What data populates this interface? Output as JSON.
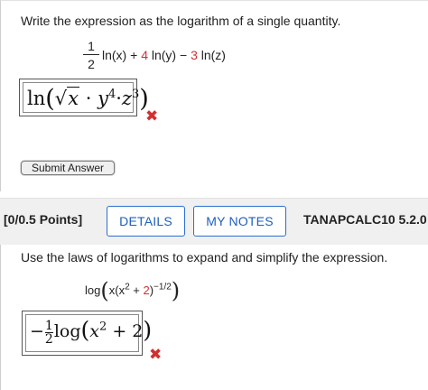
{
  "q1": {
    "prompt": "Write the expression as the logarithm of a single quantity.",
    "expr": {
      "frac_num": "1",
      "frac_den": "2",
      "t1": "ln(x) + ",
      "coef2": "4",
      "t2": " ln(y) − ",
      "coef3": "3",
      "t3": " ln(z)"
    },
    "answer": {
      "fn": "ln",
      "open": "(",
      "radicand": "x",
      "mid": " ·",
      "y": "y",
      "y_exp": "4",
      "dot": "·",
      "z": "z",
      "z_exp": "3",
      "close": ")"
    },
    "status": "✖",
    "submit_label": "Submit Answer"
  },
  "header": {
    "points": "[0/0.5 Points]",
    "details_label": "DETAILS",
    "notes_label": "MY NOTES",
    "problem_id": "TANAPCALC10 5.2.0"
  },
  "q2": {
    "prompt": "Use the laws of logarithms to expand and simplify the expression.",
    "expr": {
      "fn": "log",
      "open": "(",
      "x1": "x(x",
      "exp2": "2",
      "plus": " + ",
      "two": "2",
      "close_inner": ")",
      "outer_exp": "−1/2",
      "close": ")"
    },
    "answer": {
      "sign": "−",
      "frac_num": "1",
      "frac_den": "2",
      "fn": "log",
      "open": "(",
      "x": "x",
      "x_exp": "2",
      "rest": " + 2",
      "close": ")"
    },
    "status": "✖"
  },
  "colors": {
    "accent": "#2a6fd1",
    "error": "#d32f2f"
  },
  "icons": {
    "status": "x-mark-icon"
  }
}
